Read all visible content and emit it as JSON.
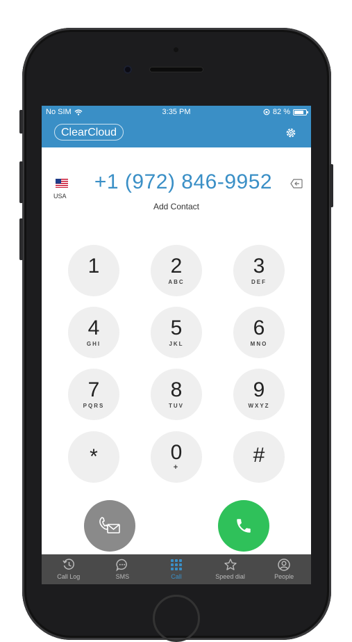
{
  "status": {
    "carrier": "No SIM",
    "time": "3:35 PM",
    "battery_text": "82 %",
    "battery_level": 0.82
  },
  "app": {
    "brand": "ClearCloud"
  },
  "dialer": {
    "country_code": "USA",
    "number": "+1 (972) 846-9952",
    "add_contact": "Add Contact"
  },
  "keypad": [
    {
      "digit": "1",
      "letters": ""
    },
    {
      "digit": "2",
      "letters": "ABC"
    },
    {
      "digit": "3",
      "letters": "DEF"
    },
    {
      "digit": "4",
      "letters": "GHI"
    },
    {
      "digit": "5",
      "letters": "JKL"
    },
    {
      "digit": "6",
      "letters": "MNO"
    },
    {
      "digit": "7",
      "letters": "PQRS"
    },
    {
      "digit": "8",
      "letters": "TUV"
    },
    {
      "digit": "9",
      "letters": "WXYZ"
    },
    {
      "digit": "*",
      "letters": ""
    },
    {
      "digit": "0",
      "letters": "+"
    },
    {
      "digit": "#",
      "letters": ""
    }
  ],
  "tabs": [
    {
      "label": "Call Log",
      "icon": "call-log-icon"
    },
    {
      "label": "SMS",
      "icon": "sms-icon"
    },
    {
      "label": "Call",
      "icon": "dialpad-icon"
    },
    {
      "label": "Speed dial",
      "icon": "star-icon"
    },
    {
      "label": "People",
      "icon": "people-icon"
    }
  ],
  "colors": {
    "accent": "#3a8fc6",
    "call_green": "#2fc15a",
    "tabbar": "#4a4a4a"
  }
}
